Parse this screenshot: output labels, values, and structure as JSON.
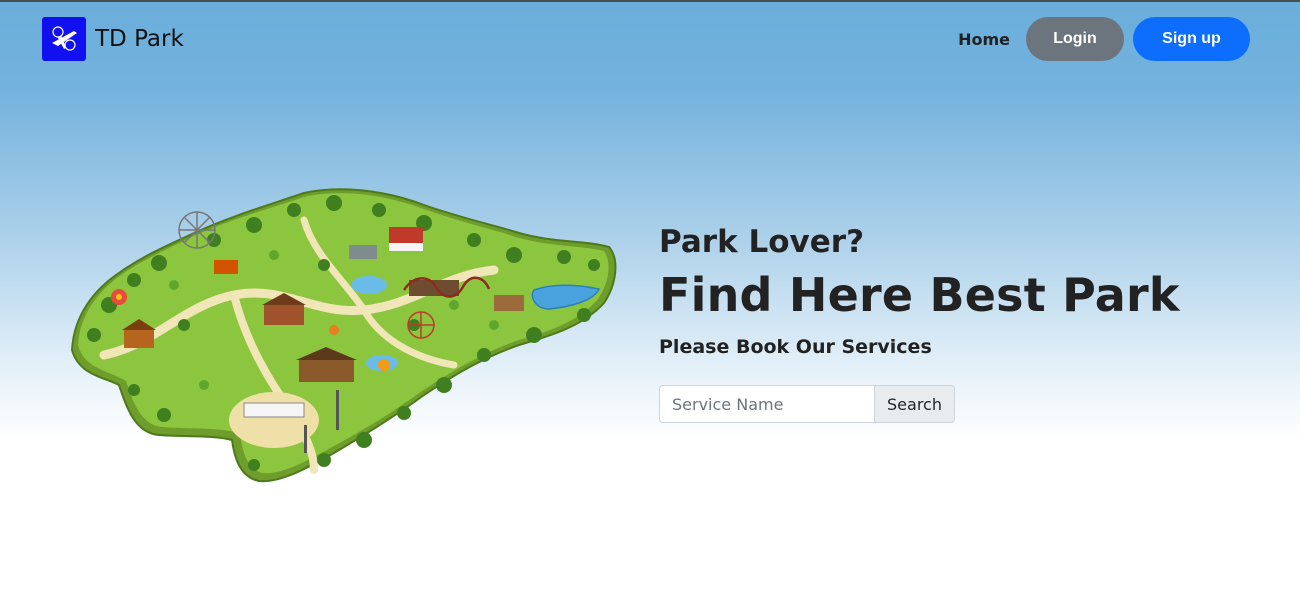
{
  "navbar": {
    "brand": "TD Park",
    "links": {
      "home": "Home",
      "login": "Login",
      "signup": "Sign up"
    }
  },
  "hero": {
    "subtitle": "Park Lover?",
    "title": "Find Here Best Park",
    "tagline": "Please Book Our Services"
  },
  "search": {
    "placeholder": "Service Name",
    "button": "Search"
  },
  "colors": {
    "brand_logo_bg": "#1010f0",
    "login_bg": "#6c757d",
    "signup_bg": "#0d6efd",
    "sky_top": "#6aaedb",
    "park_grass": "#8cc63f"
  },
  "icons": {
    "brand_logo": "airplane-icon"
  }
}
